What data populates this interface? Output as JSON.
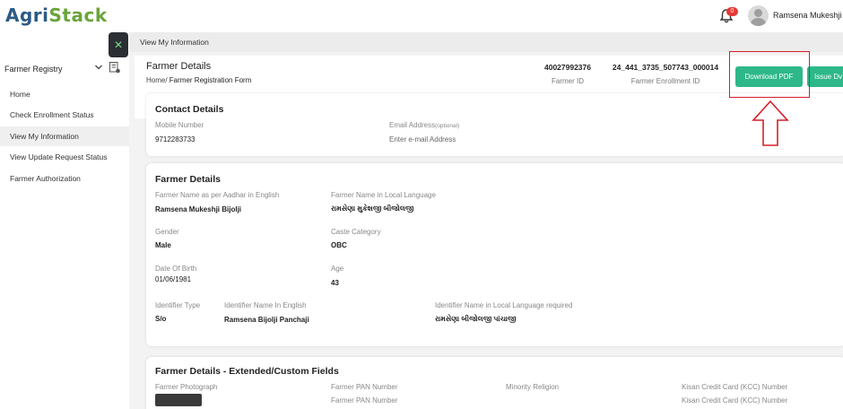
{
  "header": {
    "logo_part1": "Agri",
    "logo_part2": "Stack",
    "notification_count": "0",
    "user_name": "Ramsena Mukeshji B"
  },
  "sidebar": {
    "toggle_icon": "close-icon",
    "section_title": "Farmer Registry",
    "items": [
      {
        "label": "Home"
      },
      {
        "label": "Check Enrollment Status"
      },
      {
        "label": "View My Information"
      },
      {
        "label": "View Update Request Status"
      },
      {
        "label": "Farmer Authorization"
      }
    ]
  },
  "main": {
    "breadcrumb_bar": "View My Information",
    "page_title": "Farmer Details",
    "breadcrumb_home": "Home/",
    "breadcrumb_current": "Farmer Registration Form",
    "farmer_id_value": "40027992376",
    "farmer_id_label": "Farmer ID",
    "enrollment_id_value": "24_441_3735_507743_000014",
    "enrollment_id_label": "Farmer Enrollment ID",
    "download_pdf_label": "Download PDF",
    "issue_label": "Issue Dv"
  },
  "contact": {
    "title": "Contact Details",
    "mobile_label": "Mobile Number",
    "mobile_value": "9712283733",
    "email_label": "Email Address",
    "email_optional": "(optional)",
    "email_placeholder": "Enter e-mail Address"
  },
  "farmer": {
    "title": "Farmer Details",
    "name_en_label": "Farmer Name as per Aadhar in English",
    "name_en_value": "Ramsena Mukeshji Bijolji",
    "name_local_label": "Farmer Name in Local Language",
    "name_local_value": "રામસેણા મુકેશજી બીજોલજી",
    "gender_label": "Gender",
    "gender_value": "Male",
    "caste_label": "Caste Category",
    "caste_value": "OBC",
    "dob_label": "Date Of Birth",
    "dob_value": "01/06/1981",
    "age_label": "Age",
    "age_value": "43",
    "identifier_type_label": "Identifier Type",
    "identifier_type_value": "S/o",
    "identifier_name_en_label": "Identifier Name In English",
    "identifier_name_en_value": "Ramsena Bijolji Panchaji",
    "identifier_name_local_label": "Identifier Name in Local Language required",
    "identifier_name_local_value": "રામસેણા બીજોલજી પાંચાજી"
  },
  "extended": {
    "title": "Farmer Details - Extended/Custom Fields",
    "photo_label": "Farmer Photograph",
    "pan_label": "Farmer PAN Number",
    "pan_label_2": "Farmer PAN Number",
    "minority_label": "Minority Religion",
    "kcc_label": "Kisan Credit Card (KCC) Number",
    "kcc_label_2": "Kisan Credit Card (KCC) Number"
  },
  "colors": {
    "accent_green": "#2eb889",
    "highlight_red": "#d61f2b",
    "logo_blue": "#2c5a86",
    "logo_green": "#6aa43a"
  }
}
